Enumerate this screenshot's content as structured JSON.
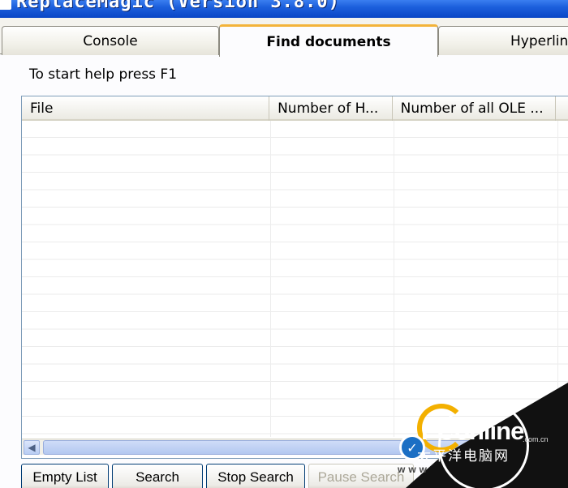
{
  "window": {
    "title": "ReplaceMagic (Version 3.8.0)"
  },
  "tabs": [
    {
      "label": "Console",
      "active": false
    },
    {
      "label": "Find documents",
      "active": true
    },
    {
      "label": "Hyperlin",
      "active": false
    }
  ],
  "help_text": "To start help press F1",
  "grid": {
    "columns": [
      "File",
      "Number of H...",
      "Number of all OLE ..."
    ],
    "rows": []
  },
  "buttons": {
    "empty_list": "Empty List",
    "search": "Search",
    "stop_search": "Stop Search",
    "pause_search": "Pause Search"
  },
  "watermark": {
    "brand": "PConline",
    "domain": ".com.cn",
    "chinese": "太平洋电脑网",
    "www": "www",
    "badge_mark": "✓"
  },
  "icons": {
    "scroll_left": "◀"
  },
  "colors": {
    "titlebar": "#0a46c6",
    "active_tab_accent": "#f3b33a",
    "watermark_orange": "#f3b000"
  }
}
